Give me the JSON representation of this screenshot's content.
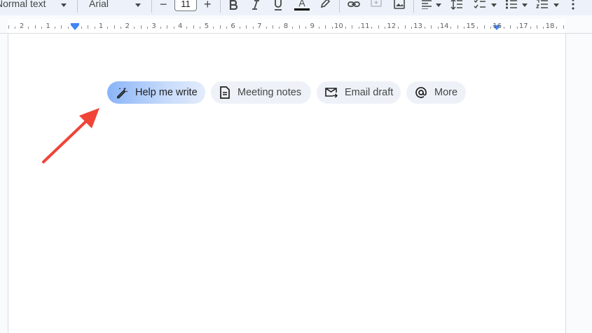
{
  "toolbar": {
    "style_select": "Normal text",
    "font_select": "Arial",
    "font_size": "11",
    "decrease_label": "−",
    "increase_label": "+",
    "text_color_letter": "A"
  },
  "ruler": {
    "labels": [
      "2",
      "1",
      "1",
      "2",
      "3",
      "4",
      "5",
      "6",
      "7",
      "8",
      "9",
      "10",
      "11",
      "12",
      "13",
      "14",
      "15",
      "16",
      "17",
      "18"
    ]
  },
  "chips": [
    {
      "label": "Help me write",
      "icon": "pen-sparkle-icon"
    },
    {
      "label": "Meeting notes",
      "icon": "document-icon"
    },
    {
      "label": "Email draft",
      "icon": "mail-arrow-icon"
    },
    {
      "label": "More",
      "icon": "at-sign-icon"
    }
  ],
  "colors": {
    "accent_blue": "#4285f4",
    "chip_bg": "#eef2f8",
    "arrow_red": "#f04437",
    "toolbar_bg": "#edf2fa"
  }
}
